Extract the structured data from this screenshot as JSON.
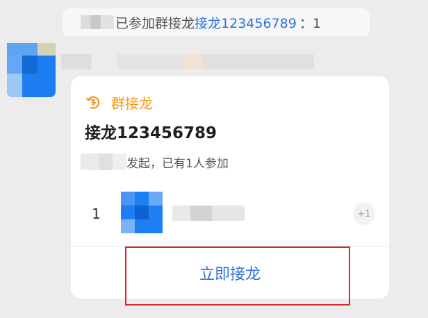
{
  "notice": {
    "text": "已参加群接龙",
    "link": "接龙123456789",
    "suffix": "：1"
  },
  "card": {
    "type_label": "群接龙",
    "type_icon": "relay-icon",
    "title": "接龙123456789",
    "status": "发起，已有1人参加",
    "participants": [
      {
        "number": "1",
        "badge": "+1"
      }
    ],
    "action_label": "立即接龙"
  },
  "colors": {
    "accent": "#f39a1b",
    "link": "#2f73d9",
    "highlight": "#d6272e",
    "background": "#ececec"
  }
}
